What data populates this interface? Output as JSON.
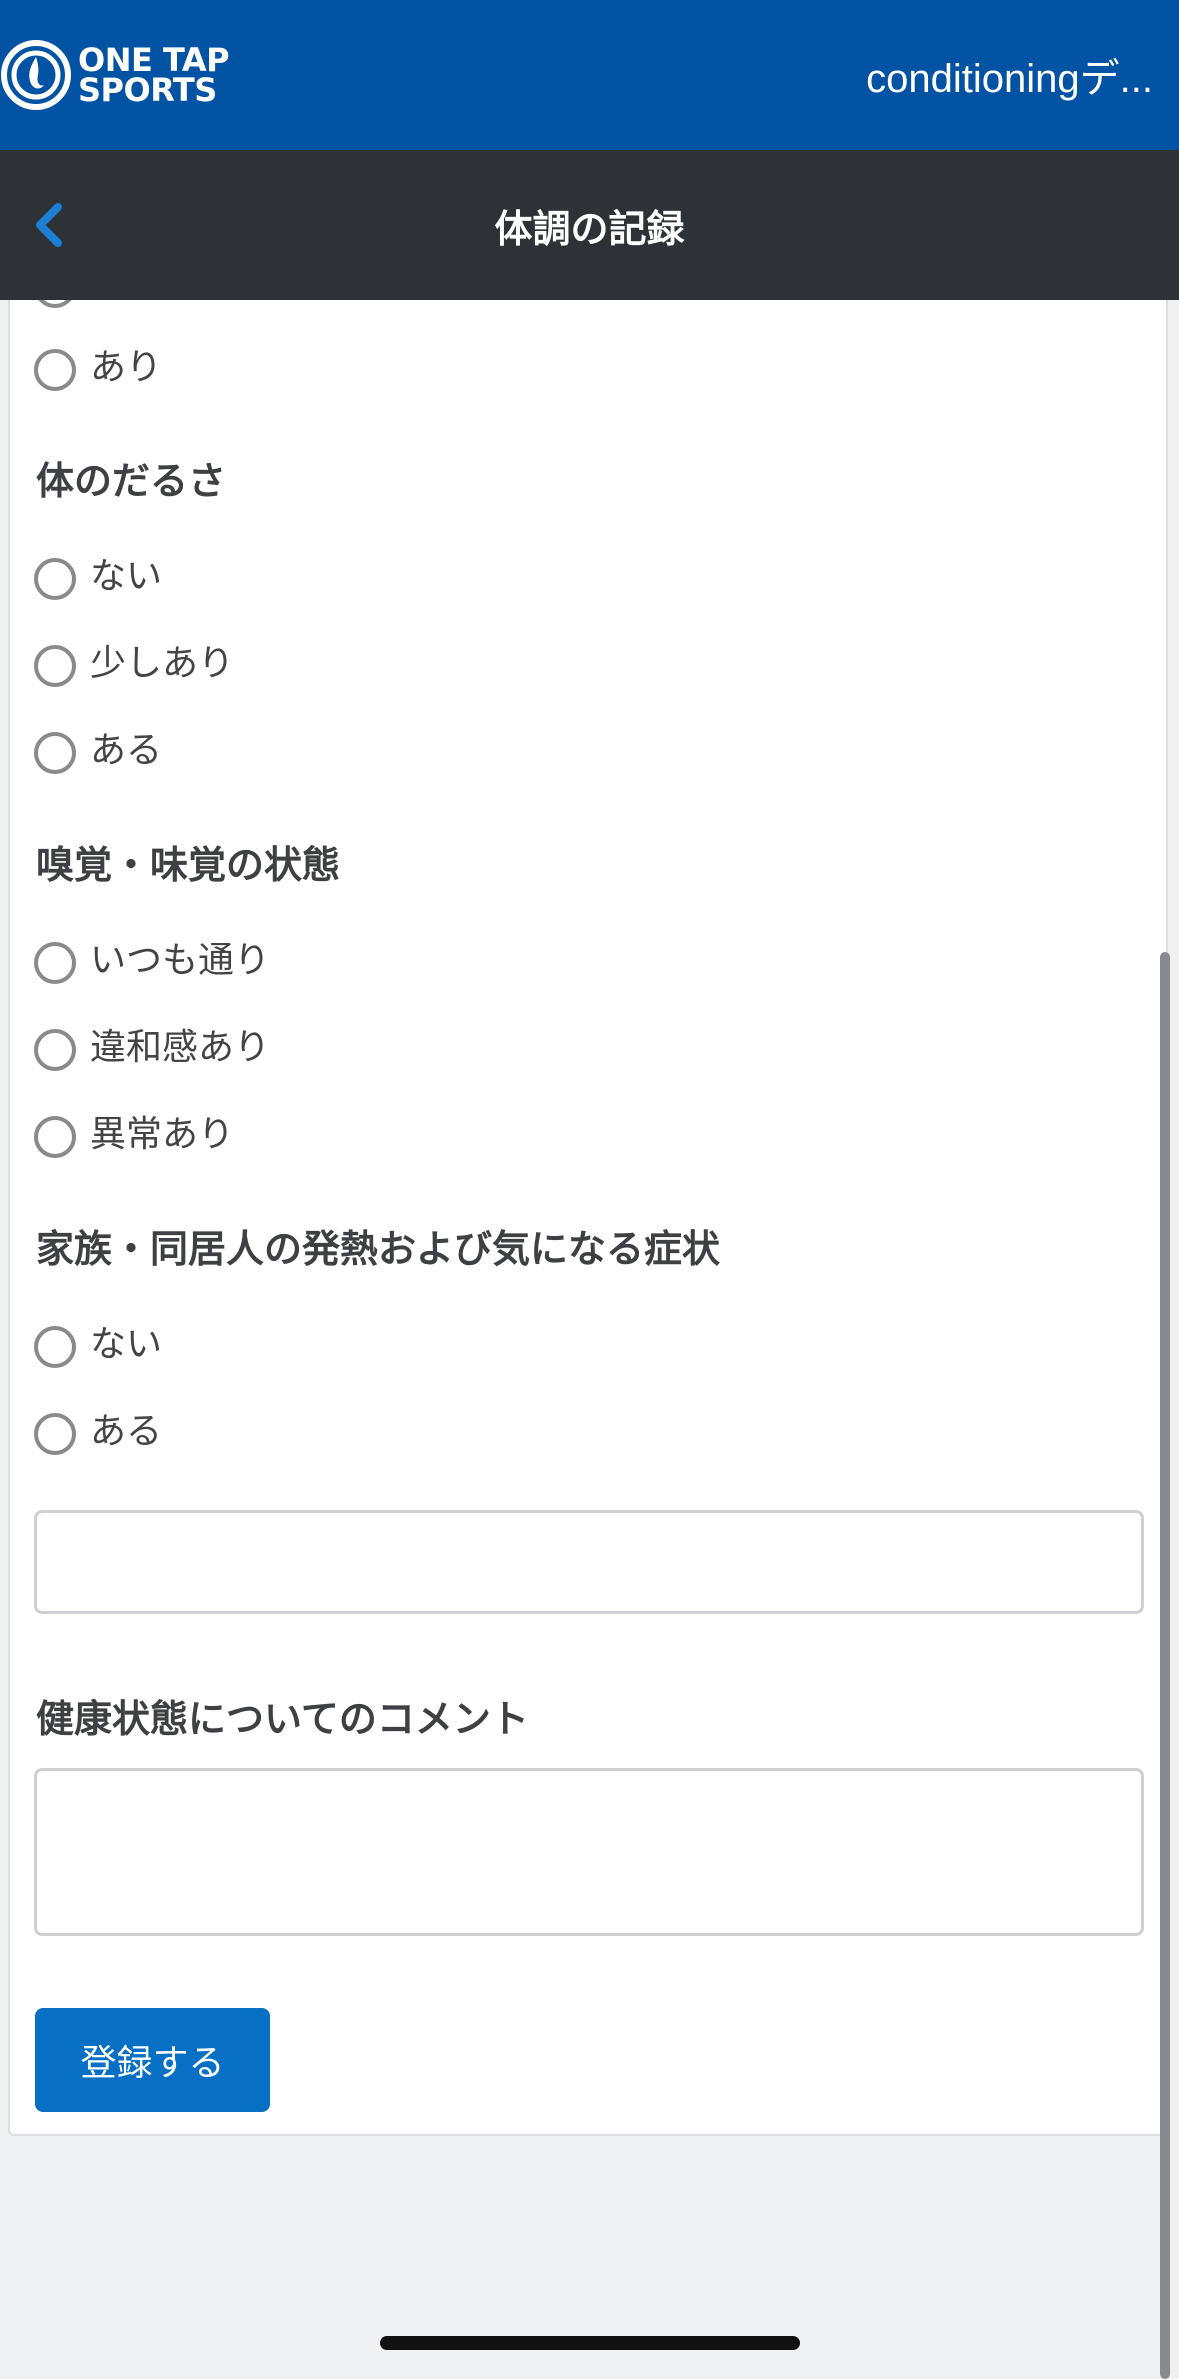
{
  "app": {
    "logo_line1": "ONE TAP",
    "logo_line2": "SPORTS",
    "window_title": "conditioningデ..."
  },
  "nav": {
    "title": "体調の記録"
  },
  "form": {
    "partial_option": "あり",
    "sections": [
      {
        "title": "体のだるさ",
        "options": [
          "ない",
          "少しあり",
          "ある"
        ]
      },
      {
        "title": "嗅覚・味覚の状態",
        "options": [
          "いつも通り",
          "違和感あり",
          "異常あり"
        ]
      },
      {
        "title": "家族・同居人の発熱および気になる症状",
        "options": [
          "ない",
          "ある"
        ]
      }
    ],
    "symptom_detail_value": "",
    "comment_title": "健康状態についてのコメント",
    "comment_value": "",
    "submit_label": "登録する"
  },
  "colors": {
    "appbar": "#0353a4",
    "navbar": "#2e3135",
    "accent": "#0870c4",
    "background": "#eff0f2"
  }
}
